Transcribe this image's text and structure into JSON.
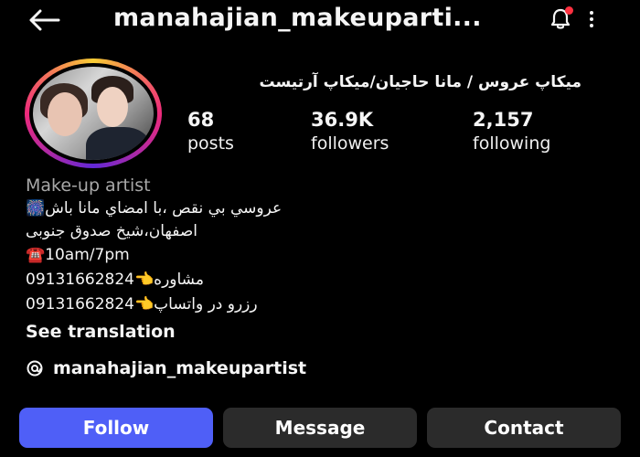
{
  "header": {
    "username": "manahajian_makeuparti...",
    "icons": [
      "back-arrow-icon",
      "notification-bell-icon",
      "more-options-icon"
    ]
  },
  "profile": {
    "display_name": "میکاپ عروس / مانا حاجیان/میکاپ آرتیست",
    "stats": {
      "posts": {
        "value": "68",
        "label": "posts"
      },
      "followers": {
        "value": "36.9K",
        "label": "followers"
      },
      "following": {
        "value": "2,157",
        "label": "following"
      }
    },
    "category": "Make-up artist",
    "bio_lines": [
      "🎆عروسي بي نقص ،با امضاي مانا باش",
      "اصفهان،شیخ صدوق جنوبی",
      "☎️10am/7pm",
      "09131662824👈مشاوره",
      " 09131662824👈رزرو در واتساپ"
    ],
    "see_translation": "See translation",
    "threads_username": "manahajian_makeupartist"
  },
  "actions": {
    "follow": "Follow",
    "message": "Message",
    "contact": "Contact"
  },
  "colors": {
    "background": "#000000",
    "follow_button": "#4f5ff7",
    "secondary_button": "#2b2b2b",
    "category_text": "#a8a8a8",
    "notification_badge": "#ff3040"
  }
}
